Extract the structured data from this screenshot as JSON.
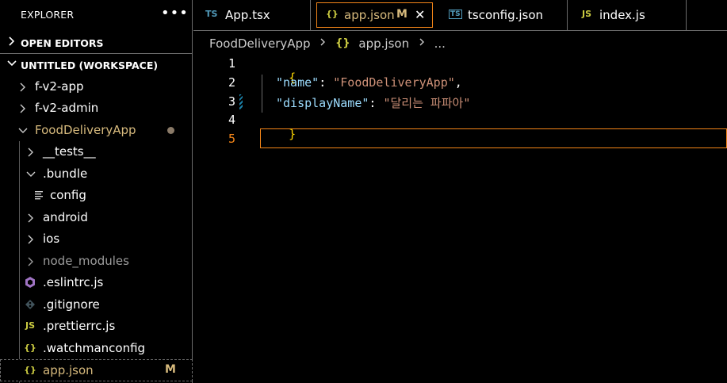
{
  "sidebar": {
    "title": "EXPLORER",
    "more": "•••",
    "sections": [
      {
        "label": "OPEN EDITORS"
      },
      {
        "label": "UNTITLED (WORKSPACE)"
      }
    ],
    "items": [
      {
        "label": "f-v2-app"
      },
      {
        "label": "f-v2-admin"
      },
      {
        "label": "FoodDeliveryApp"
      },
      {
        "label": "__tests__"
      },
      {
        "label": ".bundle"
      },
      {
        "label": "config"
      },
      {
        "label": "android"
      },
      {
        "label": "ios"
      },
      {
        "label": "node_modules"
      },
      {
        "label": ".eslintrc.js"
      },
      {
        "label": ".gitignore"
      },
      {
        "label": ".prettierrc.js",
        "icon_text": "JS"
      },
      {
        "label": ".watchmanconfig",
        "icon_text": "{}"
      },
      {
        "label": "app.json",
        "icon_text": "{}",
        "badge": "M"
      }
    ]
  },
  "tabs": [
    {
      "icon_text": "TS",
      "label": "App.tsx"
    },
    {
      "icon_text": "{}",
      "label": "app.json",
      "modified": "M",
      "close": "✕"
    },
    {
      "icon_text": "TS",
      "label": "tsconfig.json"
    },
    {
      "icon_text": "JS",
      "label": "index.js"
    }
  ],
  "breadcrumb": {
    "parts": [
      "FoodDeliveryApp",
      "app.json",
      "..."
    ],
    "icon_text": "{}"
  },
  "editor": {
    "line_numbers": [
      "1",
      "2",
      "3",
      "4",
      "5"
    ],
    "lines": {
      "l1_brace": "{",
      "l2_key": "\"name\"",
      "l2_colon": ": ",
      "l2_val": "\"FoodDeliveryApp\"",
      "l2_comma": ",",
      "l3_key": "\"displayName\"",
      "l3_colon": ": ",
      "l3_val": "\"달리는 파파아\"",
      "l4_brace": "}"
    }
  },
  "colors": {
    "accent_border": "#f38518",
    "json_icon": "#cbcb41",
    "ts_icon": "#519aba",
    "modified": "#d7ba7d"
  }
}
